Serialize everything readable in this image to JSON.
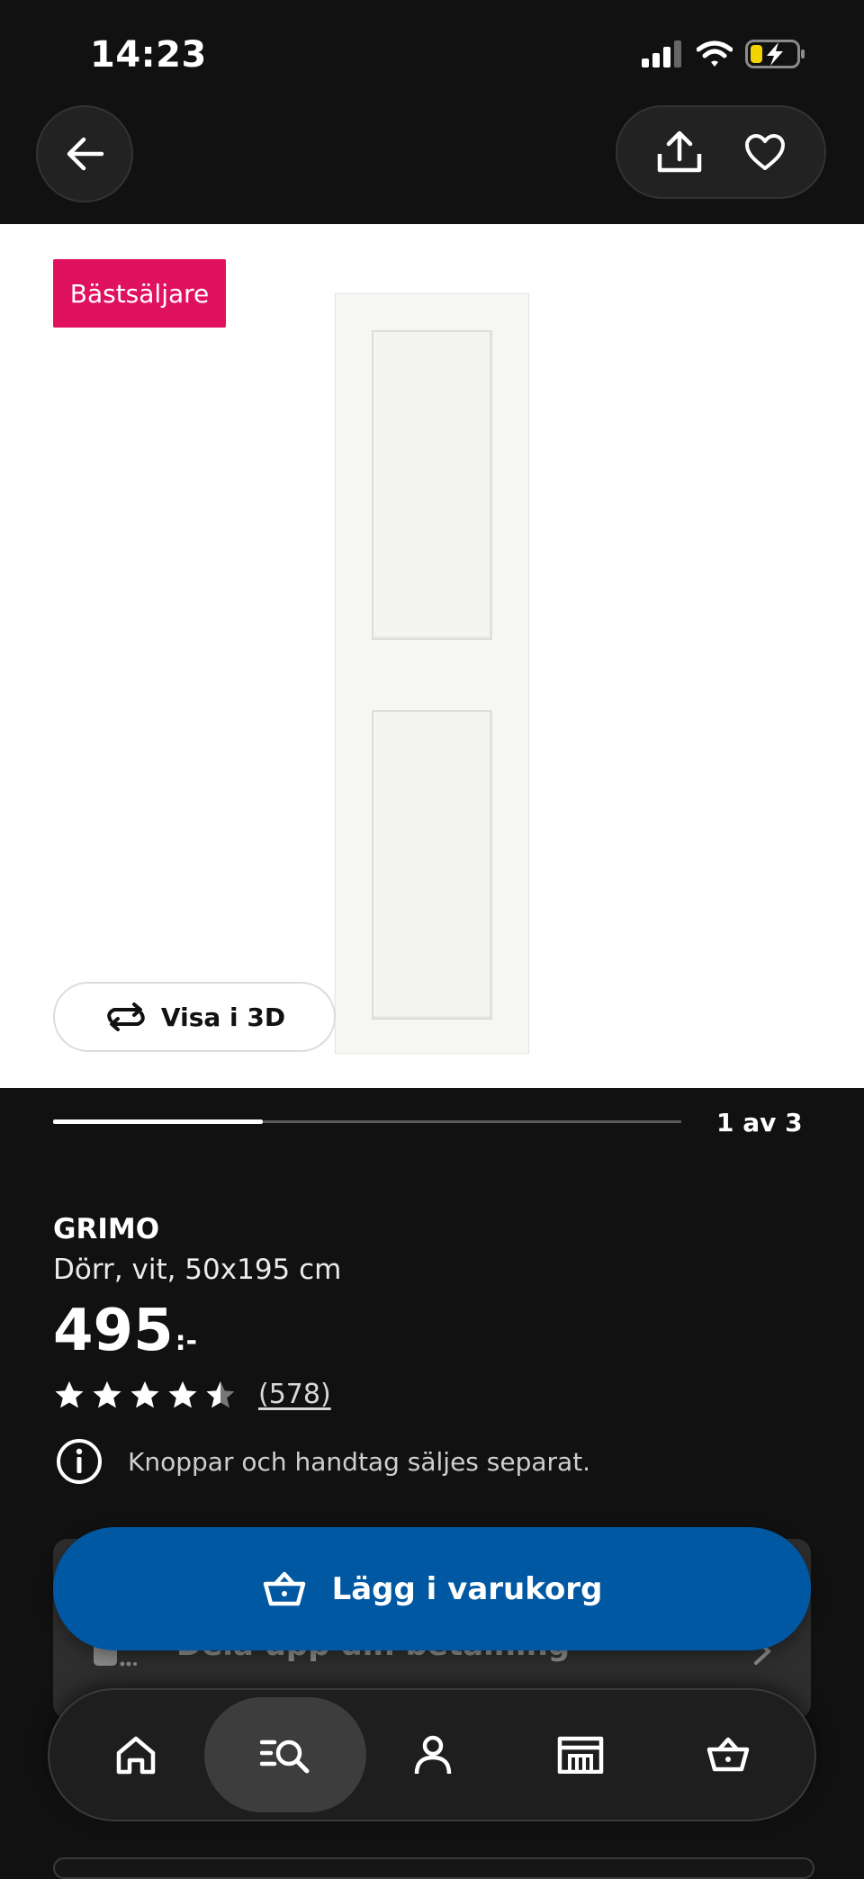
{
  "status_bar": {
    "time": "14:23"
  },
  "colors": {
    "accent": "#0058a3",
    "badge": "#e0115f",
    "background": "#111111",
    "battery": "#f2d300"
  },
  "product": {
    "badge": "Bästsäljare",
    "view_3d_label": "Visa i 3D",
    "pager": {
      "label": "1 av 3",
      "current": 1,
      "total": 3
    },
    "name": "GRIMO",
    "description": "Dörr, vit, 50x195 cm",
    "price": "495",
    "price_suffix": ":-",
    "rating": {
      "stars": 4.5,
      "max": 5,
      "count_label": "(578)"
    },
    "info": "Knoppar och handtag säljes separat."
  },
  "card": {
    "text": "Dela upp din betalning"
  },
  "cart_button": {
    "label": "Lägg i varukorg"
  },
  "icons": {
    "top": [
      "back-arrow-icon",
      "share-icon",
      "heart-icon"
    ],
    "nav": [
      "home-icon",
      "search-icon",
      "profile-icon",
      "store-icon",
      "cart-icon"
    ]
  }
}
